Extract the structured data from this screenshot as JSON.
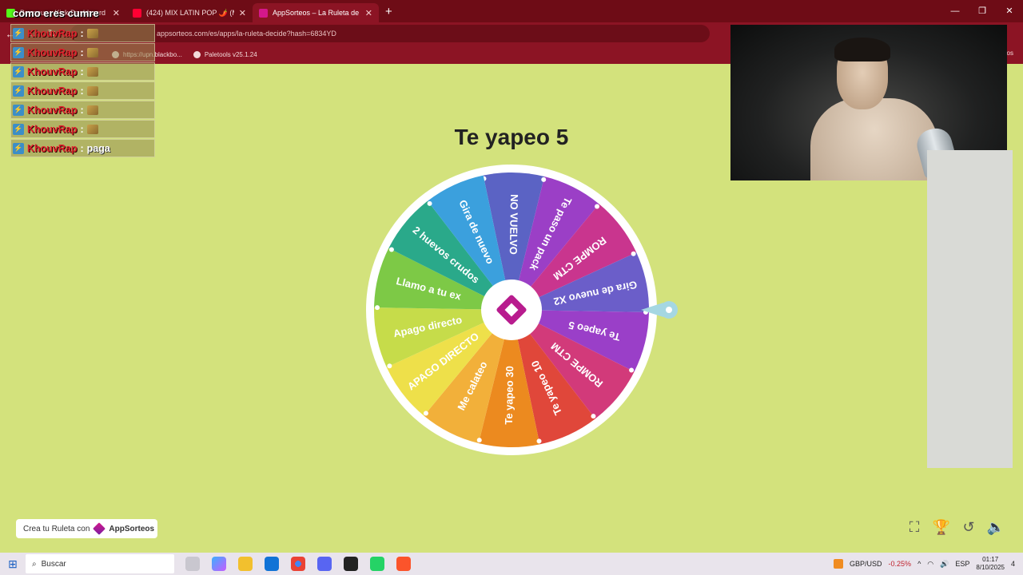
{
  "browser": {
    "tabs": [
      {
        "title": "Beenpus · Kick Dashboard",
        "favicon_color": "#53fc18",
        "active": false
      },
      {
        "title": "(424) MIX LATIN POP 🌶️ (M",
        "favicon_color": "#ff0033",
        "active": false
      },
      {
        "title": "AppSorteos – La Ruleta de la S",
        "favicon_color": "#d4188b",
        "active": true
      }
    ],
    "new_tab": "+",
    "url": "appsorteos.com/es/apps/la-ruleta-decide?hash=6834YD",
    "bookmarks": [
      {
        "label": "https://upn.blackbo..."
      },
      {
        "label": "Paletools v25.1.24"
      }
    ],
    "bookmarks_right": "tos"
  },
  "chat": {
    "header": "como eres cumre",
    "messages": [
      {
        "user": "KhouvRap",
        "sep": ":",
        "text": ""
      },
      {
        "user": "KhouvRap",
        "sep": ":",
        "text": ""
      },
      {
        "user": "KhouvRap",
        "sep": ":",
        "text": ""
      },
      {
        "user": "KhouvRap",
        "sep": ":",
        "text": ""
      },
      {
        "user": "KhouvRap",
        "sep": ":",
        "text": ""
      },
      {
        "user": "KhouvRap",
        "sep": ":",
        "text": ""
      },
      {
        "user": "KhouvRap",
        "sep": ":",
        "text": "paga"
      }
    ]
  },
  "wheel": {
    "result_title": "Te yapeo 5",
    "segments": [
      {
        "label": "NO VUELVO",
        "color": "#5b63c4"
      },
      {
        "label": "Te paso un pack",
        "color": "#9b3fc6"
      },
      {
        "label": "ROMPE CTM",
        "color": "#c9358e"
      },
      {
        "label": "Gira de nuevo X2",
        "color": "#6b5ec9"
      },
      {
        "label": "Te yapeo 5",
        "color": "#9a3fc8"
      },
      {
        "label": "ROMPE CTM",
        "color": "#d23a7a"
      },
      {
        "label": "Te yapeo 10",
        "color": "#e0473a"
      },
      {
        "label": "Te yapeo 30",
        "color": "#ec8a1f"
      },
      {
        "label": "Me calateo",
        "color": "#f2b03a"
      },
      {
        "label": "APAGO DIRECTO",
        "color": "#eee04a"
      },
      {
        "label": "Apago directo",
        "color": "#c6dc4a"
      },
      {
        "label": "Llamo a tu ex",
        "color": "#7dc946"
      },
      {
        "label": "2 huevos crudos",
        "color": "#2aa98a"
      },
      {
        "label": "Gira de nuevo",
        "color": "#3ba0dd"
      }
    ]
  },
  "branding": {
    "prefix": "Crea tu Ruleta con",
    "brand": "AppSorteos"
  },
  "tools": [
    "fullscreen-icon",
    "trophy-icon",
    "reset-icon",
    "volume-icon"
  ],
  "taskbar": {
    "search_placeholder": "Buscar",
    "ticker_label": "GBP/USD",
    "ticker_value": "-0.25%",
    "language": "ESP",
    "time": "01:17",
    "date": "8/10/2025",
    "notification_count": "4"
  }
}
